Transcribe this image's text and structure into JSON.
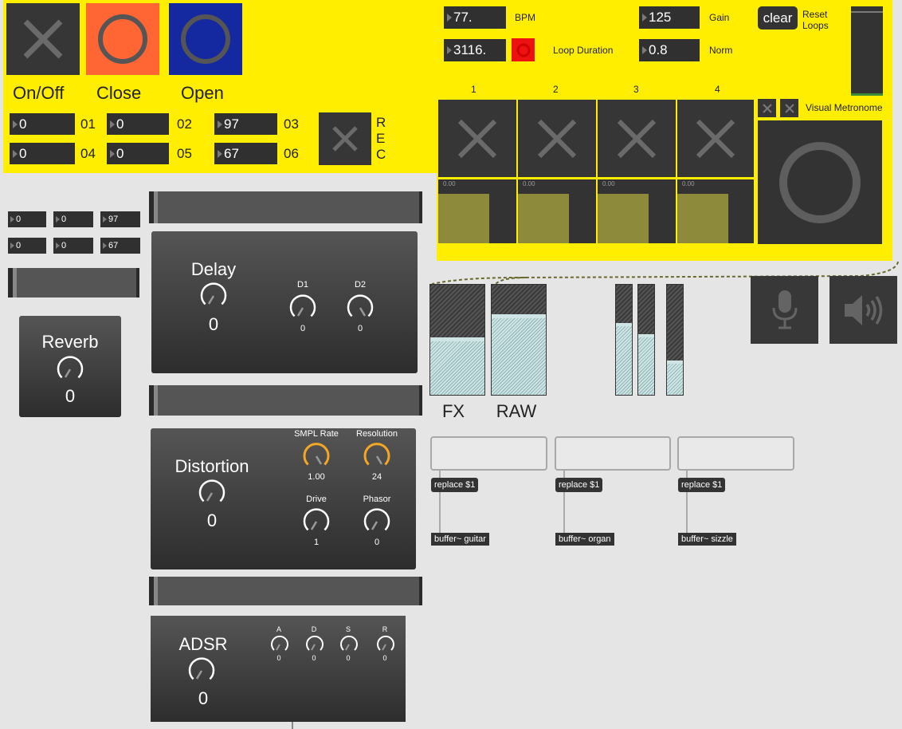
{
  "transport": {
    "onoff_label": "On/Off",
    "close_label": "Close",
    "open_label": "Open",
    "close_color": "#ff6633",
    "open_color": "#14289f"
  },
  "presets": [
    {
      "value": "0",
      "label": "01"
    },
    {
      "value": "0",
      "label": "02"
    },
    {
      "value": "97",
      "label": "03"
    },
    {
      "value": "0",
      "label": "04"
    },
    {
      "value": "0",
      "label": "05"
    },
    {
      "value": "67",
      "label": "06"
    }
  ],
  "rec_label": "R E C",
  "mini_values": [
    "0",
    "0",
    "97",
    "0",
    "0",
    "67"
  ],
  "looper": {
    "bpm_value": "77.",
    "bpm_label": "BPM",
    "gain_value": "125",
    "gain_label": "Gain",
    "duration_value": "3116.",
    "duration_label": "Loop Duration",
    "norm_value": "0.8",
    "norm_label": "Norm",
    "clear_label": "clear",
    "reset_label": "Reset Loops",
    "track_numbers": [
      "1",
      "2",
      "3",
      "4"
    ],
    "track_level_labels": [
      "0.00",
      "0.00",
      "0.00",
      "0.00"
    ],
    "track_levels": [
      0.77,
      0.77,
      0.77,
      0.77
    ],
    "metronome_label": "Visual Metronome",
    "output_meter_level": 0.03
  },
  "reverb": {
    "title": "Reverb",
    "value": "0"
  },
  "delay": {
    "title": "Delay",
    "value": "0",
    "knobs": [
      {
        "label": "D1",
        "value": "0"
      },
      {
        "label": "D2",
        "value": "0"
      }
    ]
  },
  "distortion": {
    "title": "Distortion",
    "value": "0",
    "knobs": [
      {
        "label": "SMPL Rate",
        "value": "1.00"
      },
      {
        "label": "Resolution",
        "value": "24"
      },
      {
        "label": "Drive",
        "value": "1"
      },
      {
        "label": "Phasor",
        "value": "0"
      }
    ]
  },
  "adsr": {
    "title": "ADSR",
    "value": "0",
    "knobs": [
      {
        "label": "A",
        "value": "0"
      },
      {
        "label": "D",
        "value": "0"
      },
      {
        "label": "S",
        "value": "0"
      },
      {
        "label": "R",
        "value": "0"
      }
    ]
  },
  "meters": {
    "fx_label": "FX",
    "raw_label": "RAW",
    "fx_level": 0.52,
    "raw_level": 0.73,
    "small_levels": [
      0.65,
      0.55,
      0.31
    ]
  },
  "buffers": [
    {
      "message": "replace $1",
      "object": "buffer~ guitar"
    },
    {
      "message": "replace $1",
      "object": "buffer~ organ"
    },
    {
      "message": "replace $1",
      "object": "buffer~ sizzle"
    }
  ],
  "icons": {
    "toggle": "x-icon",
    "button": "circle-icon",
    "mic": "microphone-icon",
    "speaker": "speaker-icon"
  },
  "colors": {
    "panel_yellow": "#ffee00",
    "accent_orange": "#f4a626",
    "rec_red": "#ee1111"
  }
}
